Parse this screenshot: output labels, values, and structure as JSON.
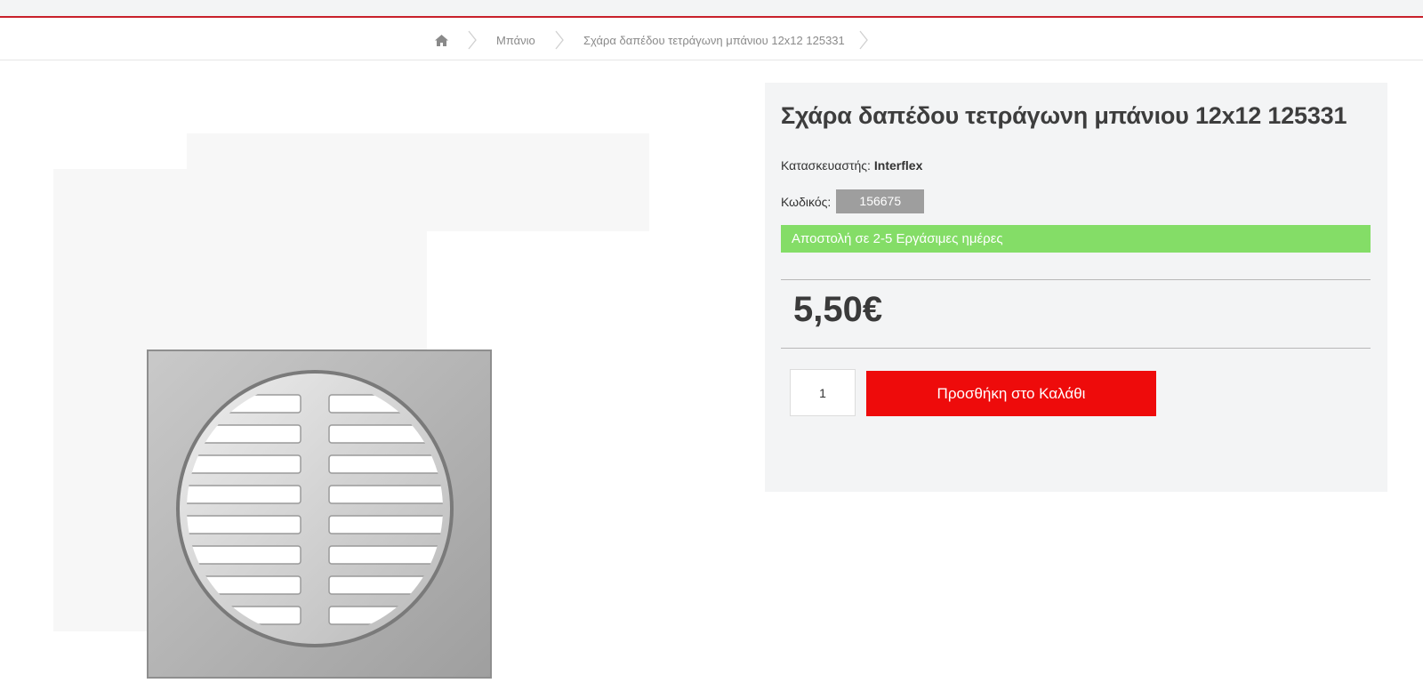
{
  "breadcrumb": {
    "home_icon": "home-icon",
    "items": [
      {
        "label": "Μπάνιο"
      },
      {
        "label": "Σχάρα δαπέδου τετράγωνη μπάνιου 12x12 125331"
      }
    ]
  },
  "product": {
    "title": "Σχάρα δαπέδου τετράγωνη μπάνιου 12x12 125331",
    "manufacturer_label": "Κατασκευαστής:",
    "manufacturer": "Interflex",
    "code_label": "Κωδικός:",
    "code": "156675",
    "shipping": "Αποστολή σε 2-5 Εργάσιμες ημέρες",
    "price": "5,50€",
    "quantity": "1",
    "add_to_cart": "Προσθήκη στο Καλάθι"
  },
  "colors": {
    "accent_red": "#ee0b0b",
    "ship_green": "#84dd67",
    "code_gray": "#9e9e9e",
    "top_border": "#c8202a"
  }
}
